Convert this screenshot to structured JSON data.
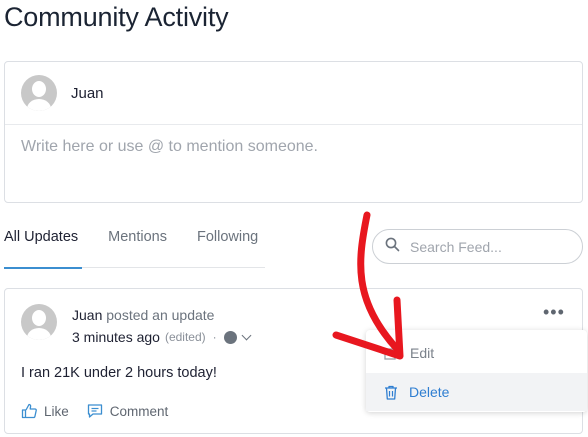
{
  "page": {
    "title": "Community Activity"
  },
  "composer": {
    "user_name": "Juan",
    "placeholder": "Write here or use @ to mention someone."
  },
  "tabs": [
    {
      "label": "All Updates",
      "active": true
    },
    {
      "label": "Mentions",
      "active": false
    },
    {
      "label": "Following",
      "active": false
    }
  ],
  "search": {
    "placeholder": "Search Feed..."
  },
  "post": {
    "author": "Juan",
    "action": "posted an update",
    "time": "3 minutes ago",
    "edited": "(edited)",
    "separator": "·",
    "text": "I ran 21K under 2 hours today!",
    "like_label": "Like",
    "comment_label": "Comment",
    "more_label": "•••"
  },
  "menu": {
    "edit_label": "Edit",
    "delete_label": "Delete"
  },
  "colors": {
    "accent": "#3b8ed0",
    "delete_text": "#2f7ed1",
    "annotation_arrow": "#e8171f"
  }
}
